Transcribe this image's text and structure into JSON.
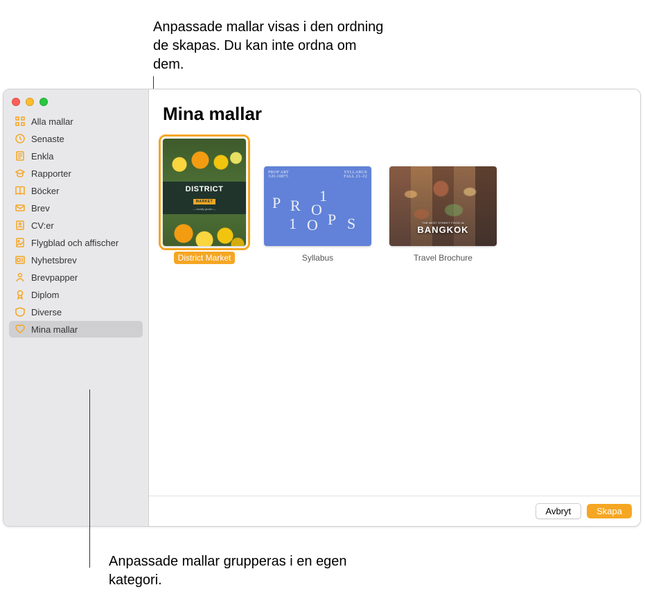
{
  "callouts": {
    "top": "Anpassade mallar visas i den ordning de skapas. Du kan inte ordna om dem.",
    "bottom": "Anpassade mallar grupperas i en egen kategori."
  },
  "sidebar": {
    "items": [
      {
        "label": "Alla mallar",
        "icon": "grid-icon"
      },
      {
        "label": "Senaste",
        "icon": "clock-icon"
      },
      {
        "label": "Enkla",
        "icon": "doc-icon"
      },
      {
        "label": "Rapporter",
        "icon": "graduation-icon"
      },
      {
        "label": "Böcker",
        "icon": "book-icon"
      },
      {
        "label": "Brev",
        "icon": "envelope-icon"
      },
      {
        "label": "CV:er",
        "icon": "person-icon"
      },
      {
        "label": "Flygblad och affischer",
        "icon": "poster-icon"
      },
      {
        "label": "Nyhetsbrev",
        "icon": "news-icon"
      },
      {
        "label": "Brevpapper",
        "icon": "stationery-icon"
      },
      {
        "label": "Diplom",
        "icon": "ribbon-icon"
      },
      {
        "label": "Diverse",
        "icon": "tag-icon"
      },
      {
        "label": "Mina mallar",
        "icon": "heart-icon",
        "selected": true
      }
    ]
  },
  "main": {
    "title": "Mina mallar",
    "templates": [
      {
        "label": "District Market",
        "selected": true,
        "thumb": {
          "kind": "district",
          "title": "DISTRICT",
          "subtitle": "MARKET"
        }
      },
      {
        "label": "Syllabus",
        "selected": false,
        "thumb": {
          "kind": "syllabus",
          "top_left_1": "PROP ART",
          "top_left_2": "GD-10875",
          "top_right_1": "SYLLABUS",
          "top_right_2": "FALL 21–22",
          "glyphs": [
            "P",
            "R",
            "1",
            "O",
            "1",
            "O",
            "P",
            "S"
          ]
        }
      },
      {
        "label": "Travel Brochure",
        "selected": false,
        "thumb": {
          "kind": "travel",
          "subtitle": "THE BEST STREET FOOD IN",
          "title": "BANGKOK"
        }
      }
    ]
  },
  "footer": {
    "cancel_label": "Avbryt",
    "create_label": "Skapa"
  },
  "colors": {
    "accent": "#f5a623"
  }
}
